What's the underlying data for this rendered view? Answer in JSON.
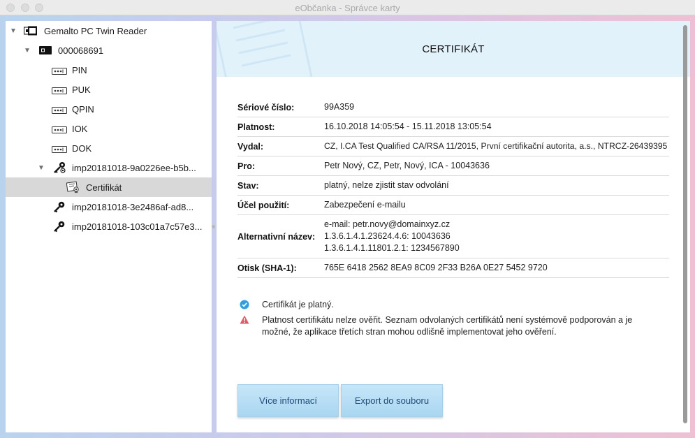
{
  "window": {
    "title": "eObčanka - Správce karty"
  },
  "tree": {
    "reader": "Gemalto PC Twin Reader",
    "card": "000068691",
    "items": [
      {
        "label": "PIN"
      },
      {
        "label": "PUK"
      },
      {
        "label": "QPIN"
      },
      {
        "label": "IOK"
      },
      {
        "label": "DOK"
      }
    ],
    "key1": "imp20181018-9a0226ee-b5b...",
    "key1_child": "Certifikát",
    "key2": "imp20181018-3e2486af-ad8...",
    "key3": "imp20181018-103c01a7c57e3..."
  },
  "header": {
    "title": "CERTIFIKÁT"
  },
  "certificate": {
    "rows": [
      {
        "key": "Sériové číslo:",
        "value": "99A359"
      },
      {
        "key": "Platnost:",
        "value": "16.10.2018 14:05:54 - 15.11.2018 13:05:54"
      },
      {
        "key": "Vydal:",
        "value": "CZ, I.CA Test Qualified CA/RSA 11/2015, První certifikační autorita, a.s., NTRCZ-26439395"
      },
      {
        "key": "Pro:",
        "value": "Petr Nový, CZ, Petr, Nový, ICA - 10043636"
      },
      {
        "key": "Stav:",
        "value": "platný, nelze zjistit stav odvolání"
      },
      {
        "key": "Účel použití:",
        "value": "Zabezpečení e-mailu"
      },
      {
        "key": "Alternativní název:",
        "value_lines": [
          "e-mail: petr.novy@domainxyz.cz",
          "1.3.6.1.4.1.23624.4.6: 10043636",
          "1.3.6.1.4.1.11801.2.1: 1234567890"
        ]
      },
      {
        "key": "Otisk (SHA-1):",
        "value": "765E 6418 2562 8EA9 8C09 2F33 B26A 0E27 5452 9720"
      }
    ]
  },
  "status": {
    "valid_text": "Certifikát je platný.",
    "warning_text": "Platnost certifikátu nelze ověřit. Seznam odvolaných certifikátů není systémově podporován a je možné, že aplikace třetích stran mohou odlišně implementovat jeho ověření.",
    "valid_color": "#2f9fe0",
    "warning_color": "#e05a6a"
  },
  "buttons": {
    "more_info": "Více informací",
    "export": "Export do souboru"
  }
}
